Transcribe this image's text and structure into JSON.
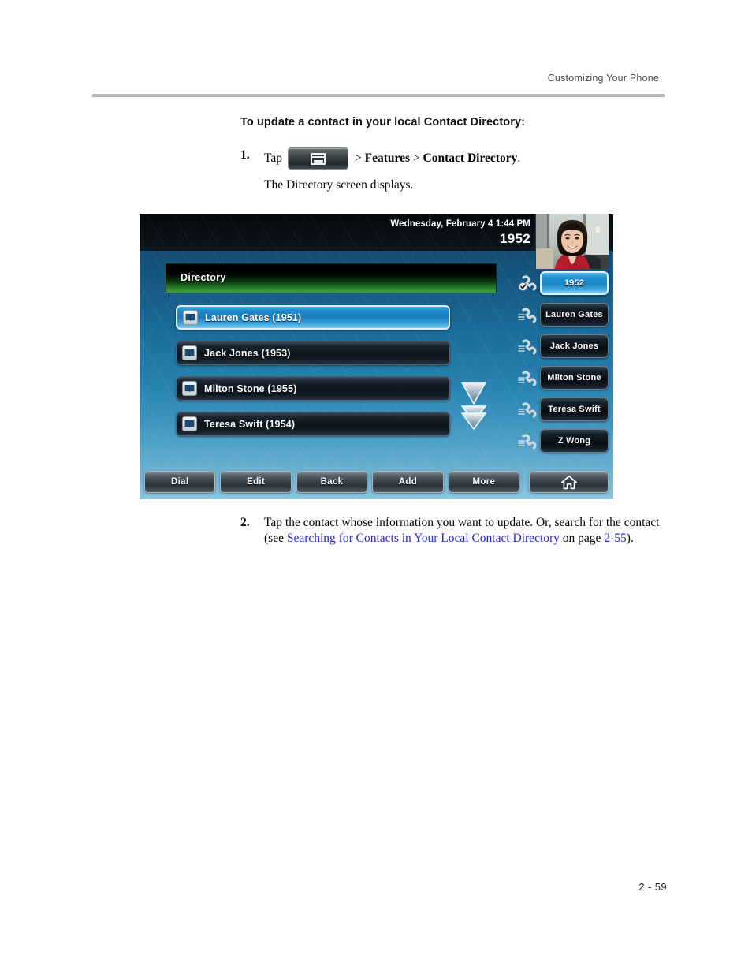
{
  "running_head": {
    "title": "Customizing Your Phone"
  },
  "section": {
    "heading": "To update a contact in your local Contact Directory:"
  },
  "steps": [
    {
      "number": "1.",
      "lead": "Tap",
      "key_icon": "menu-key-icon",
      "trail_prefix": "> ",
      "trail_bold_1": "Features",
      "trail_sep": " > ",
      "trail_bold_2": "Contact Directory",
      "trail_end": ".",
      "result": "The Directory screen displays."
    },
    {
      "number": "2.",
      "text_before_link": "Tap the contact whose information you want to update. Or, search for the contact (see ",
      "link_text": "Searching for Contacts in Your Local Contact Directory",
      "text_between": " on page ",
      "link_page": "2-55",
      "text_after": ")."
    }
  ],
  "phone": {
    "status_bar": {
      "datetime": "Wednesday, February 4  1:44 PM",
      "extension": "1952"
    },
    "avatar": {
      "icon": "video-avatar-photo"
    },
    "directory": {
      "title": "Directory",
      "contacts": [
        {
          "label": "Lauren Gates (1951)",
          "icon": "contact-book-icon",
          "selected": true
        },
        {
          "label": "Jack Jones (1953)",
          "icon": "contact-book-icon",
          "selected": false
        },
        {
          "label": "Milton Stone (1955)",
          "icon": "contact-book-icon",
          "selected": false
        },
        {
          "label": "Teresa Swift (1954)",
          "icon": "contact-book-icon",
          "selected": false
        }
      ],
      "scroll_icons": [
        "scroll-down-arrow-icon",
        "scroll-page-down-arrow-icon"
      ]
    },
    "line_keys": [
      {
        "label": "1952",
        "icon": "handset-registered-icon",
        "active": true
      },
      {
        "label": "Lauren Gates",
        "icon": "handset-line-icon",
        "active": false
      },
      {
        "label": "Jack Jones",
        "icon": "handset-line-icon",
        "active": false
      },
      {
        "label": "Milton Stone",
        "icon": "handset-line-icon",
        "active": false
      },
      {
        "label": "Teresa Swift",
        "icon": "handset-line-icon",
        "active": false
      },
      {
        "label": "Z Wong",
        "icon": "handset-line-icon",
        "active": false
      }
    ],
    "softkeys": [
      {
        "label": "Dial"
      },
      {
        "label": "Edit"
      },
      {
        "label": "Back"
      },
      {
        "label": "Add"
      },
      {
        "label": "More"
      }
    ],
    "home_key": {
      "icon": "home-icon"
    }
  },
  "footer": {
    "page_number": "2 - 59"
  },
  "colors": {
    "link": "#2a2ad0",
    "directory_title_green": "#3f9e42",
    "selected_blue": "#1d85c8",
    "rule_gray": "#b8b8b8"
  }
}
